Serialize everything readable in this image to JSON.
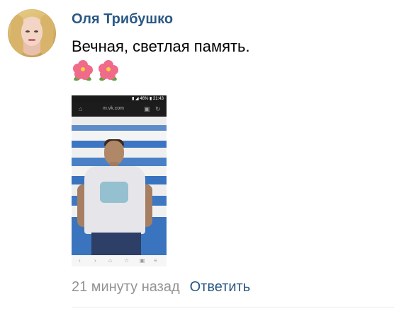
{
  "comment": {
    "author": "Оля Трибушко",
    "text": "Вечная, светлая память.",
    "emojis": [
      "hibiscus-flower",
      "hibiscus-flower"
    ],
    "attachment": {
      "type": "photo",
      "status_bar_text": "▮ ◢ 46% ▮ 21:43",
      "url_text": "m.vk.com"
    },
    "time": "21 минуту назад",
    "reply_label": "Ответить"
  },
  "colors": {
    "link": "#2a5885",
    "muted": "#939393",
    "text": "#000000",
    "divider": "#e7e8ec"
  }
}
